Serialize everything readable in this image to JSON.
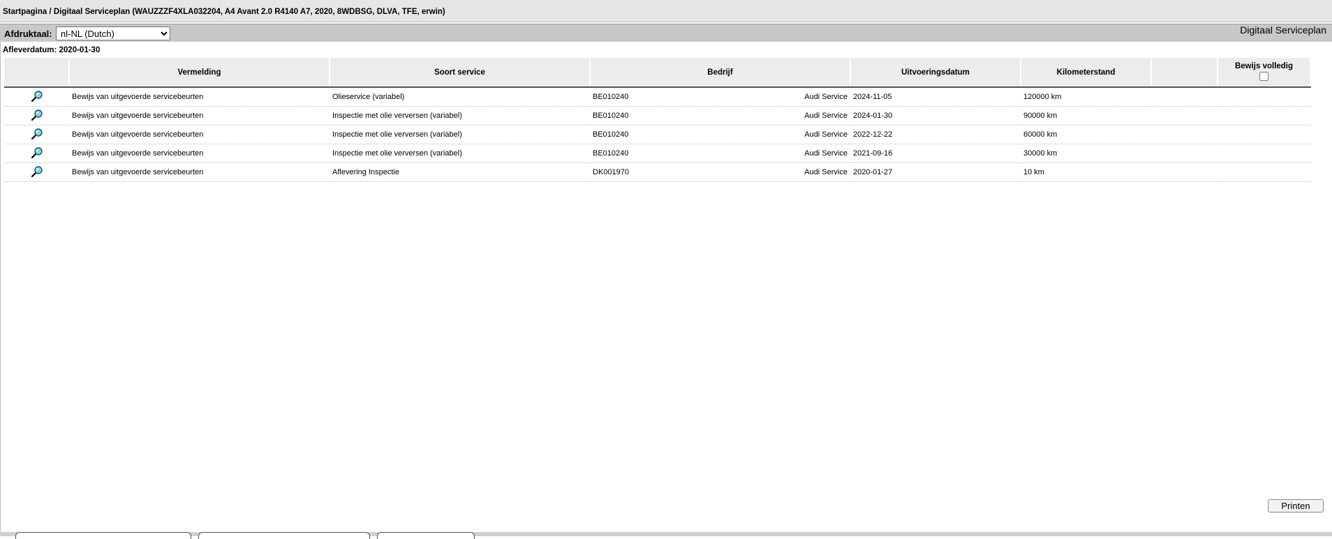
{
  "breadcrumb": "Startpagina / Digitaal Serviceplan (WAUZZZF4XLA032204, A4 Avant 2.0 R4140 A7, 2020, 8WDBSG, DLVA, TFE, erwin)",
  "toolbar": {
    "language_label": "Afdruktaal:",
    "language_selected": "nl-NL (Dutch)",
    "page_title": "Digitaal Serviceplan"
  },
  "delivery_date": "Afleverdatum: 2020-01-30",
  "table": {
    "headers": {
      "icon": "",
      "entry": "Vermelding",
      "service_type": "Soort service",
      "company": "Bedrijf",
      "execution_date": "Uitvoeringsdatum",
      "mileage": "Kilometerstand",
      "extra": "",
      "proof_complete": "Bewijs volledig"
    },
    "rows": [
      {
        "entry": "Bewijs van uitgevoerde servicebeurten",
        "service_type": "Olieservice (variabel)",
        "company_code": "BE010240",
        "company_name": "Audi Service",
        "date": "2024-11-05",
        "mileage": "120000 km"
      },
      {
        "entry": "Bewijs van uitgevoerde servicebeurten",
        "service_type": "Inspectie met olie verversen (variabel)",
        "company_code": "BE010240",
        "company_name": "Audi Service",
        "date": "2024-01-30",
        "mileage": "90000 km"
      },
      {
        "entry": "Bewijs van uitgevoerde servicebeurten",
        "service_type": "Inspectie met olie verversen (variabel)",
        "company_code": "BE010240",
        "company_name": "Audi Service",
        "date": "2022-12-22",
        "mileage": "60000 km"
      },
      {
        "entry": "Bewijs van uitgevoerde servicebeurten",
        "service_type": "Inspectie met olie verversen (variabel)",
        "company_code": "BE010240",
        "company_name": "Audi Service",
        "date": "2021-09-16",
        "mileage": "30000 km"
      },
      {
        "entry": "Bewijs van uitgevoerde servicebeurten",
        "service_type": "Aflevering Inspectie",
        "company_code": "DK001970",
        "company_name": "Audi Service",
        "date": "2020-01-27",
        "mileage": "10 km"
      }
    ]
  },
  "print_label": "Printen",
  "icons": {
    "row_detail": "magnifier-icon"
  },
  "colors": {
    "header_bg": "#ececec",
    "toolbar_bg": "#c8c8c8",
    "icon_lens": "#7fd8e0"
  }
}
